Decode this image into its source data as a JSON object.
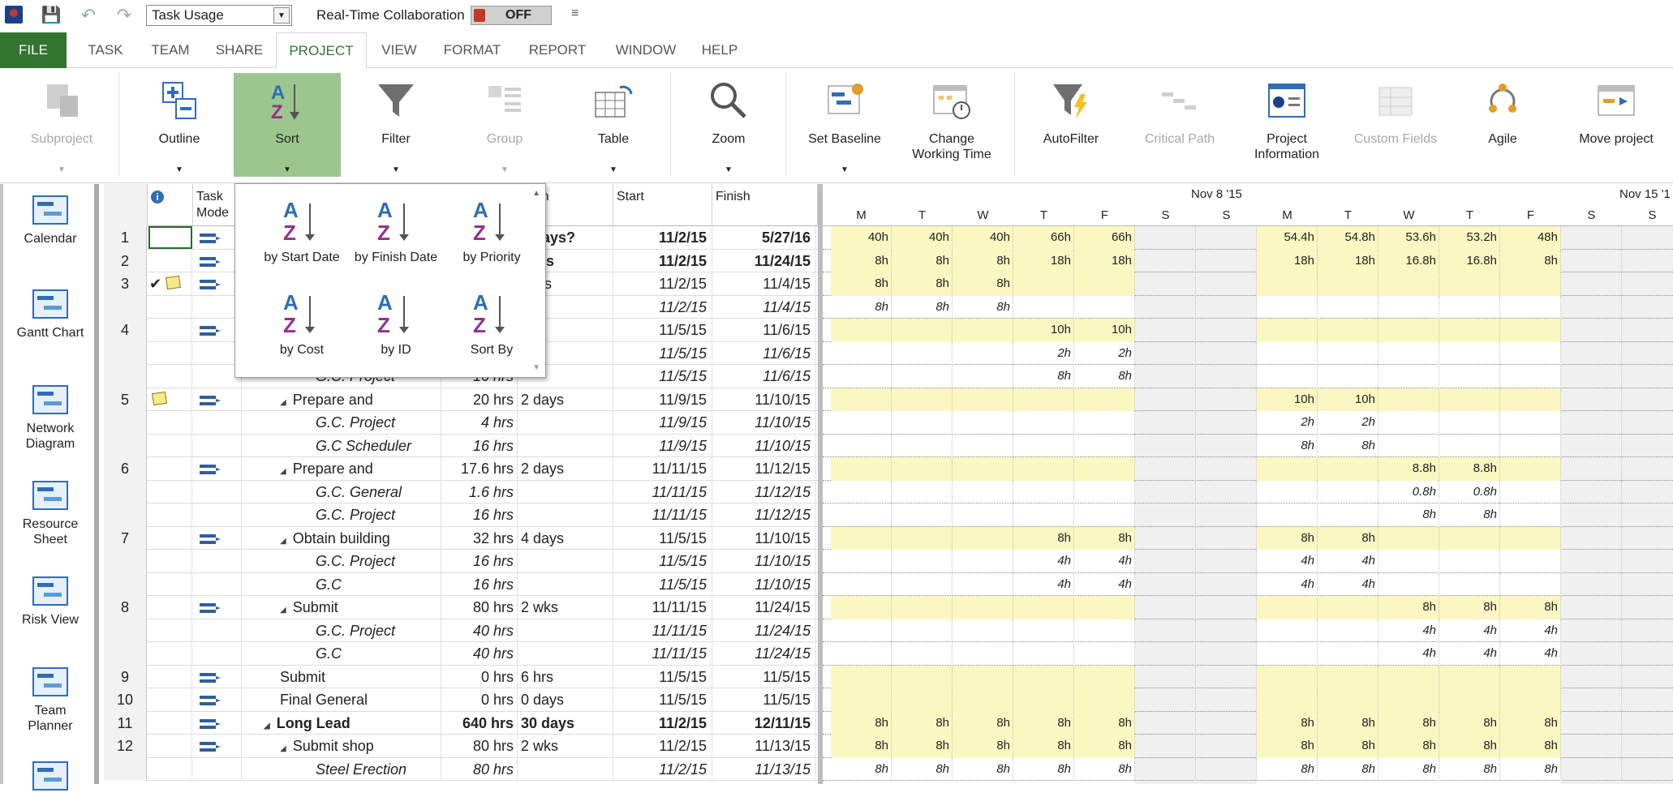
{
  "qat": {
    "view_select": "Task Usage",
    "rtc_label": "Real-Time Collaboration",
    "rtc_state": "OFF"
  },
  "tabs": [
    "FILE",
    "TASK",
    "TEAM",
    "SHARE",
    "PROJECT",
    "VIEW",
    "FORMAT",
    "REPORT",
    "WINDOW",
    "HELP"
  ],
  "active_tab": "PROJECT",
  "ribbon": {
    "subproject": "Subproject",
    "outline": "Outline",
    "sort": "Sort",
    "filter": "Filter",
    "group": "Group",
    "table": "Table",
    "zoom": "Zoom",
    "set_baseline": "Set Baseline",
    "change_working_time_1": "Change",
    "change_working_time_2": "Working Time",
    "autofilter": "AutoFilter",
    "critical_path": "Critical Path",
    "project_information_1": "Project",
    "project_information_2": "Information",
    "custom_fields": "Custom Fields",
    "agile": "Agile",
    "move_project": "Move project"
  },
  "viewbar": {
    "calendar": "Calendar",
    "gantt_chart": "Gantt Chart",
    "network_1": "Network",
    "network_2": "Diagram",
    "resource_1": "Resource",
    "resource_2": "Sheet",
    "risk_view": "Risk View",
    "team_1": "Team",
    "team_2": "Planner"
  },
  "sheet": {
    "headers": {
      "mode_1": "Task",
      "mode_2": "Mode",
      "duration": "ation",
      "start": "Start",
      "finish": "Finish"
    },
    "rows": [
      {
        "id": "1",
        "mode": true,
        "name": "",
        "work": "",
        "dur": "7 days?",
        "start": "11/2/15",
        "finish": "5/27/16",
        "bold": true
      },
      {
        "id": "2",
        "mode": true,
        "name": "",
        "work": "",
        "dur": "days",
        "start": "11/2/15",
        "finish": "11/24/15",
        "bold": true
      },
      {
        "id": "3",
        "mode": true,
        "check": true,
        "note": true,
        "name": "",
        "work": "",
        "dur": "days",
        "start": "11/2/15",
        "finish": "11/4/15"
      },
      {
        "id": "",
        "mode": false,
        "name": "",
        "work": "",
        "dur": "",
        "start": "11/2/15",
        "finish": "11/4/15",
        "italic": true
      },
      {
        "id": "4",
        "mode": true,
        "name": "",
        "work": "",
        "dur": "ays",
        "start": "11/5/15",
        "finish": "11/6/15"
      },
      {
        "id": "",
        "mode": false,
        "name": "",
        "work": "",
        "dur": "",
        "start": "11/5/15",
        "finish": "11/6/15",
        "italic": true
      },
      {
        "id": "",
        "mode": false,
        "name": "G.C. Project",
        "work": "16 hrs",
        "dur": "",
        "start": "11/5/15",
        "finish": "11/6/15",
        "italic": true,
        "indent": 2
      },
      {
        "id": "5",
        "mode": true,
        "note": true,
        "name": "Prepare and",
        "work": "20 hrs",
        "dur": "2 days",
        "start": "11/9/15",
        "finish": "11/10/15",
        "tri": true,
        "indent": 1
      },
      {
        "id": "",
        "mode": false,
        "name": "G.C. Project",
        "work": "4 hrs",
        "dur": "",
        "start": "11/9/15",
        "finish": "11/10/15",
        "italic": true,
        "indent": 2
      },
      {
        "id": "",
        "mode": false,
        "name": "G.C Scheduler",
        "work": "16 hrs",
        "dur": "",
        "start": "11/9/15",
        "finish": "11/10/15",
        "italic": true,
        "indent": 2
      },
      {
        "id": "6",
        "mode": true,
        "name": "Prepare and",
        "work": "17.6 hrs",
        "dur": "2 days",
        "start": "11/11/15",
        "finish": "11/12/15",
        "tri": true,
        "indent": 1
      },
      {
        "id": "",
        "mode": false,
        "name": "G.C. General",
        "work": "1.6 hrs",
        "dur": "",
        "start": "11/11/15",
        "finish": "11/12/15",
        "italic": true,
        "indent": 2
      },
      {
        "id": "",
        "mode": false,
        "name": "G.C. Project",
        "work": "16 hrs",
        "dur": "",
        "start": "11/11/15",
        "finish": "11/12/15",
        "italic": true,
        "indent": 2
      },
      {
        "id": "7",
        "mode": true,
        "name": "Obtain building",
        "work": "32 hrs",
        "dur": "4 days",
        "start": "11/5/15",
        "finish": "11/10/15",
        "tri": true,
        "indent": 1
      },
      {
        "id": "",
        "mode": false,
        "name": "G.C. Project",
        "work": "16 hrs",
        "dur": "",
        "start": "11/5/15",
        "finish": "11/10/15",
        "italic": true,
        "indent": 2
      },
      {
        "id": "",
        "mode": false,
        "name": "G.C",
        "work": "16 hrs",
        "dur": "",
        "start": "11/5/15",
        "finish": "11/10/15",
        "italic": true,
        "indent": 2
      },
      {
        "id": "8",
        "mode": true,
        "name": "Submit",
        "work": "80 hrs",
        "dur": "2 wks",
        "start": "11/11/15",
        "finish": "11/24/15",
        "tri": true,
        "indent": 1
      },
      {
        "id": "",
        "mode": false,
        "name": "G.C. Project",
        "work": "40 hrs",
        "dur": "",
        "start": "11/11/15",
        "finish": "11/24/15",
        "italic": true,
        "indent": 2
      },
      {
        "id": "",
        "mode": false,
        "name": "G.C",
        "work": "40 hrs",
        "dur": "",
        "start": "11/11/15",
        "finish": "11/24/15",
        "italic": true,
        "indent": 2
      },
      {
        "id": "9",
        "mode": true,
        "name": "Submit",
        "work": "0 hrs",
        "dur": "6 hrs",
        "start": "11/5/15",
        "finish": "11/5/15",
        "indent": 1
      },
      {
        "id": "10",
        "mode": true,
        "name": "Final General",
        "work": "0 hrs",
        "dur": "0 days",
        "start": "11/5/15",
        "finish": "11/5/15",
        "indent": 1
      },
      {
        "id": "11",
        "mode": true,
        "name": "Long Lead",
        "work": "640 hrs",
        "dur": "30 days",
        "start": "11/2/15",
        "finish": "12/11/15",
        "bold": true,
        "tri": true,
        "indent": 0
      },
      {
        "id": "12",
        "mode": true,
        "name": "Submit shop",
        "work": "80 hrs",
        "dur": "2 wks",
        "start": "11/2/15",
        "finish": "11/13/15",
        "tri": true,
        "indent": 1
      },
      {
        "id": "",
        "mode": false,
        "name": "Steel Erection",
        "work": "80 hrs",
        "dur": "",
        "start": "11/2/15",
        "finish": "11/13/15",
        "italic": true,
        "indent": 2
      }
    ]
  },
  "timeline": {
    "week1": "Nov 8 '15",
    "week2": "Nov 15 '1",
    "days": [
      "M",
      "T",
      "W",
      "T",
      "F",
      "S",
      "S",
      "M",
      "T",
      "W",
      "T",
      "F",
      "S",
      "S"
    ],
    "rows": [
      [
        "40h",
        "40h",
        "40h",
        "66h",
        "66h",
        "",
        "",
        "54.4h",
        "54.8h",
        "53.6h",
        "53.2h",
        "48h",
        "",
        ""
      ],
      [
        "8h",
        "8h",
        "8h",
        "18h",
        "18h",
        "",
        "",
        "18h",
        "18h",
        "16.8h",
        "16.8h",
        "8h",
        "",
        ""
      ],
      [
        "8h",
        "8h",
        "8h",
        "",
        "",
        "",
        "",
        "",
        "",
        "",
        "",
        "",
        "",
        ""
      ],
      [
        "8h",
        "8h",
        "8h",
        "",
        "",
        "",
        "",
        "",
        "",
        "",
        "",
        "",
        "",
        ""
      ],
      [
        "",
        "",
        "",
        "10h",
        "10h",
        "",
        "",
        "",
        "",
        "",
        "",
        "",
        "",
        ""
      ],
      [
        "",
        "",
        "",
        "2h",
        "2h",
        "",
        "",
        "",
        "",
        "",
        "",
        "",
        "",
        ""
      ],
      [
        "",
        "",
        "",
        "8h",
        "8h",
        "",
        "",
        "",
        "",
        "",
        "",
        "",
        "",
        ""
      ],
      [
        "",
        "",
        "",
        "",
        "",
        "",
        "",
        "10h",
        "10h",
        "",
        "",
        "",
        "",
        ""
      ],
      [
        "",
        "",
        "",
        "",
        "",
        "",
        "",
        "2h",
        "2h",
        "",
        "",
        "",
        "",
        ""
      ],
      [
        "",
        "",
        "",
        "",
        "",
        "",
        "",
        "8h",
        "8h",
        "",
        "",
        "",
        "",
        ""
      ],
      [
        "",
        "",
        "",
        "",
        "",
        "",
        "",
        "",
        "",
        "8.8h",
        "8.8h",
        "",
        "",
        ""
      ],
      [
        "",
        "",
        "",
        "",
        "",
        "",
        "",
        "",
        "",
        "0.8h",
        "0.8h",
        "",
        "",
        ""
      ],
      [
        "",
        "",
        "",
        "",
        "",
        "",
        "",
        "",
        "",
        "8h",
        "8h",
        "",
        "",
        ""
      ],
      [
        "",
        "",
        "",
        "8h",
        "8h",
        "",
        "",
        "8h",
        "8h",
        "",
        "",
        "",
        "",
        ""
      ],
      [
        "",
        "",
        "",
        "4h",
        "4h",
        "",
        "",
        "4h",
        "4h",
        "",
        "",
        "",
        "",
        ""
      ],
      [
        "",
        "",
        "",
        "4h",
        "4h",
        "",
        "",
        "4h",
        "4h",
        "",
        "",
        "",
        "",
        ""
      ],
      [
        "",
        "",
        "",
        "",
        "",
        "",
        "",
        "",
        "",
        "8h",
        "8h",
        "8h",
        "",
        ""
      ],
      [
        "",
        "",
        "",
        "",
        "",
        "",
        "",
        "",
        "",
        "4h",
        "4h",
        "4h",
        "",
        ""
      ],
      [
        "",
        "",
        "",
        "",
        "",
        "",
        "",
        "",
        "",
        "4h",
        "4h",
        "4h",
        "",
        ""
      ],
      [
        "",
        "",
        "",
        "",
        "",
        "",
        "",
        "",
        "",
        "",
        "",
        "",
        "",
        ""
      ],
      [
        "",
        "",
        "",
        "",
        "",
        "",
        "",
        "",
        "",
        "",
        "",
        "",
        "",
        ""
      ],
      [
        "8h",
        "8h",
        "8h",
        "8h",
        "8h",
        "",
        "",
        "8h",
        "8h",
        "8h",
        "8h",
        "8h",
        "",
        ""
      ],
      [
        "8h",
        "8h",
        "8h",
        "8h",
        "8h",
        "",
        "",
        "8h",
        "8h",
        "8h",
        "8h",
        "8h",
        "",
        ""
      ],
      [
        "8h",
        "8h",
        "8h",
        "8h",
        "8h",
        "",
        "",
        "8h",
        "8h",
        "8h",
        "8h",
        "8h",
        "",
        ""
      ]
    ],
    "yellow_rows": [
      0,
      1,
      2,
      4,
      7,
      10,
      13,
      16,
      19,
      20,
      21,
      22
    ],
    "italic_rows": [
      3,
      5,
      6,
      8,
      9,
      11,
      12,
      14,
      15,
      17,
      18,
      23
    ]
  },
  "sort_menu": {
    "items": [
      "by Start Date",
      "by Finish Date",
      "by Priority",
      "by Cost",
      "by ID",
      "Sort By"
    ],
    "icon_letters": [
      "A",
      "Z"
    ]
  }
}
